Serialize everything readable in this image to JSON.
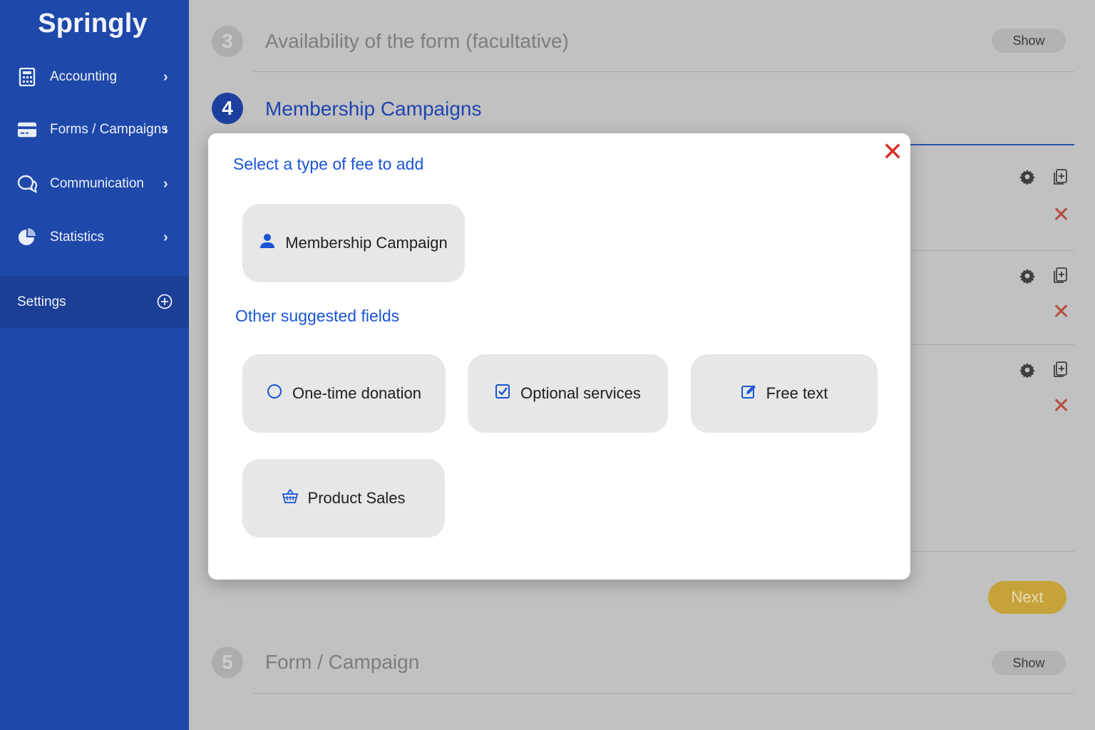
{
  "sidebar": {
    "brand": "Springly",
    "items": [
      {
        "label": "Accounting",
        "icon": "calculator-icon"
      },
      {
        "label": "Forms / Campaigns",
        "icon": "credit-card-icon"
      },
      {
        "label": "Communication",
        "icon": "chat-bubbles-icon"
      },
      {
        "label": "Statistics",
        "icon": "pie-chart-icon"
      }
    ],
    "settings": {
      "label": "Settings",
      "icon": "plus-circle-icon"
    }
  },
  "steps": [
    {
      "number": "3",
      "title": "Availability of the form (facultative)",
      "action": "Show"
    },
    {
      "number": "4",
      "title": "Membership Campaigns"
    },
    {
      "number": "5",
      "title": "Form / Campaign",
      "action": "Show"
    }
  ],
  "next_label": "Next",
  "modal": {
    "heading": "Select a type of fee to add",
    "primary_option": {
      "label": "Membership Campaign",
      "icon": "user-icon"
    },
    "subheading": "Other suggested fields",
    "options": [
      {
        "label": "One-time donation",
        "icon": "radio-circle-icon"
      },
      {
        "label": "Optional services",
        "icon": "checkbox-checked-icon"
      },
      {
        "label": "Free text",
        "icon": "edit-icon"
      },
      {
        "label": "Product Sales",
        "icon": "basket-icon"
      }
    ]
  },
  "colors": {
    "sidebar": "#1e48aa",
    "accent_blue": "#1a55d6",
    "close_red": "#d9312b",
    "next_gold": "#c6a33a"
  }
}
